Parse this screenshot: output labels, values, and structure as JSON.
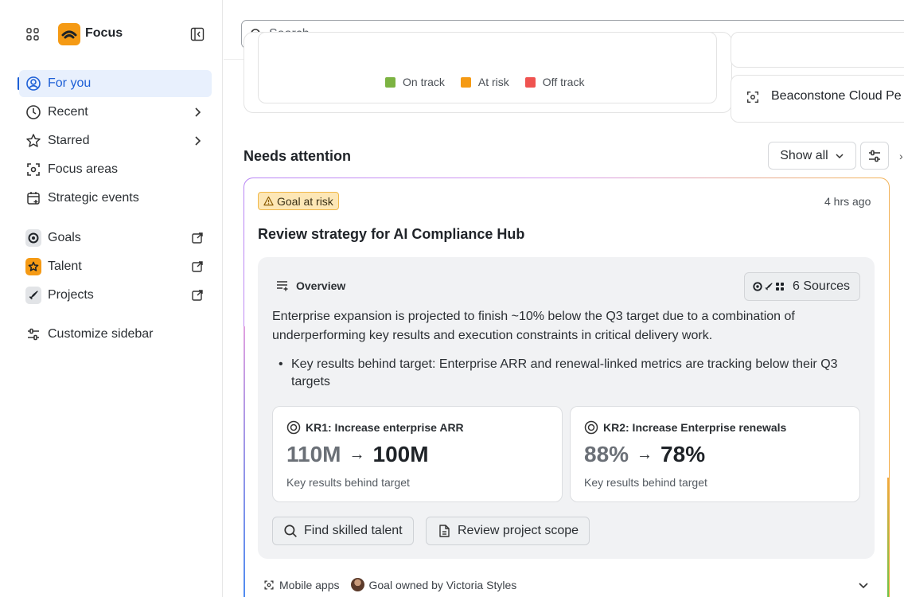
{
  "app": {
    "brand": "Focus"
  },
  "sidebar": {
    "items": [
      {
        "label": "For you",
        "icon": "user-circle-icon"
      },
      {
        "label": "Recent",
        "icon": "clock-icon"
      },
      {
        "label": "Starred",
        "icon": "star-icon"
      },
      {
        "label": "Focus areas",
        "icon": "focus-frame-icon"
      },
      {
        "label": "Strategic events",
        "icon": "calendar-plus-icon"
      },
      {
        "label": "Goals",
        "icon": "goals-app-icon"
      },
      {
        "label": "Talent",
        "icon": "talent-app-icon"
      },
      {
        "label": "Projects",
        "icon": "projects-app-icon"
      },
      {
        "label": "Customize sidebar",
        "icon": "customize-icon"
      }
    ]
  },
  "search": {
    "placeholder": "Search"
  },
  "chart_card": {
    "legend": [
      {
        "label": "On track",
        "color": "#7cb342"
      },
      {
        "label": "At risk",
        "color": "#f59a14"
      },
      {
        "label": "Off track",
        "color": "#ef5350"
      }
    ]
  },
  "side_card": {
    "label": "Beaconstone Cloud Pe"
  },
  "attention": {
    "title": "Needs attention",
    "filter_label": "Show all",
    "card": {
      "badge": "Goal at risk",
      "time": "4 hrs ago",
      "title": "Review strategy for AI Compliance Hub",
      "overview_label": "Overview",
      "sources_label": "6 Sources",
      "summary": "Enterprise expansion is projected to finish ~10% below the Q3 target due to a combination of underperforming key results and execution constraints in critical delivery work.",
      "bullet": "Key results behind target: Enterprise ARR and renewal-linked metrics are tracking below their Q3 targets",
      "key_results": [
        {
          "title": "KR1: Increase enterprise ARR",
          "from": "110M",
          "to": "100M",
          "subtitle": "Key results behind target"
        },
        {
          "title": "KR2: Increase Enterprise renewals",
          "from": "88%",
          "to": "78%",
          "subtitle": "Key results behind target"
        }
      ],
      "actions": [
        {
          "label": "Find skilled talent",
          "icon": "search-icon"
        },
        {
          "label": "Review project scope",
          "icon": "document-icon"
        }
      ],
      "footer": {
        "focus_area": "Mobile apps",
        "owner": "Goal owned by Victoria Styles"
      }
    }
  },
  "colors": {
    "accent": "#1d5fd6",
    "brand": "#f59a14",
    "risk_badge": "#fde7b6"
  }
}
